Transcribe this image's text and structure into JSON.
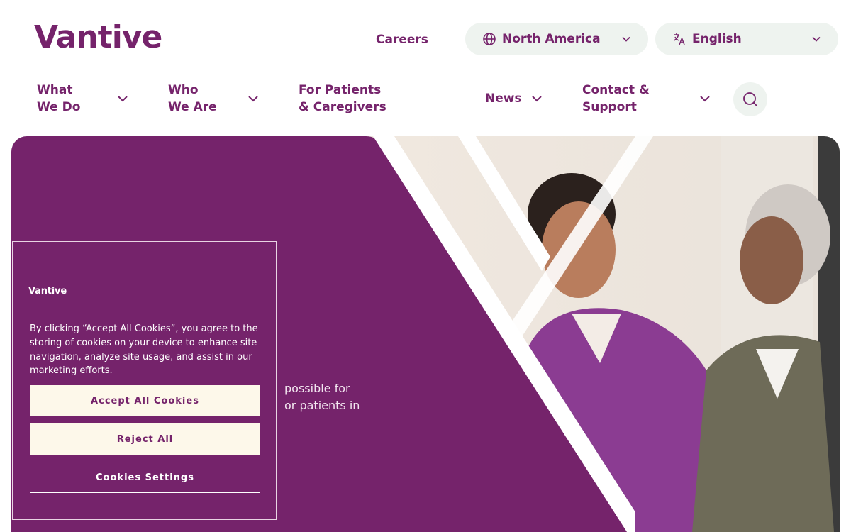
{
  "brand": {
    "logo_text": "Vantive",
    "accent_color": "#75236b"
  },
  "header": {
    "careers_label": "Careers",
    "region": {
      "icon": "globe-icon",
      "label": "North America"
    },
    "language": {
      "icon": "translate-icon",
      "label": "English"
    }
  },
  "nav": {
    "items": [
      {
        "line1": "What",
        "line2": "We Do",
        "has_dropdown": true
      },
      {
        "line1": "Who",
        "line2": "We Are",
        "has_dropdown": true
      },
      {
        "line1": "For Patients",
        "line2": "& Caregivers",
        "has_dropdown": false
      },
      {
        "line1": "News",
        "line2": "",
        "has_dropdown": true
      },
      {
        "line1": "Contact &",
        "line2": "Support",
        "has_dropdown": true
      }
    ],
    "search_icon": "search-icon"
  },
  "hero": {
    "text_line1": "possible for",
    "text_line2": "or patients in"
  },
  "cookie_banner": {
    "logo_text": "Vantive",
    "message": "By clicking “Accept All Cookies”, you agree to the storing of cookies on your device to enhance site navigation, analyze site usage, and assist in our marketing efforts.",
    "accept_label": "Accept All Cookies",
    "reject_label": "Reject All",
    "settings_label": "Cookies Settings"
  }
}
